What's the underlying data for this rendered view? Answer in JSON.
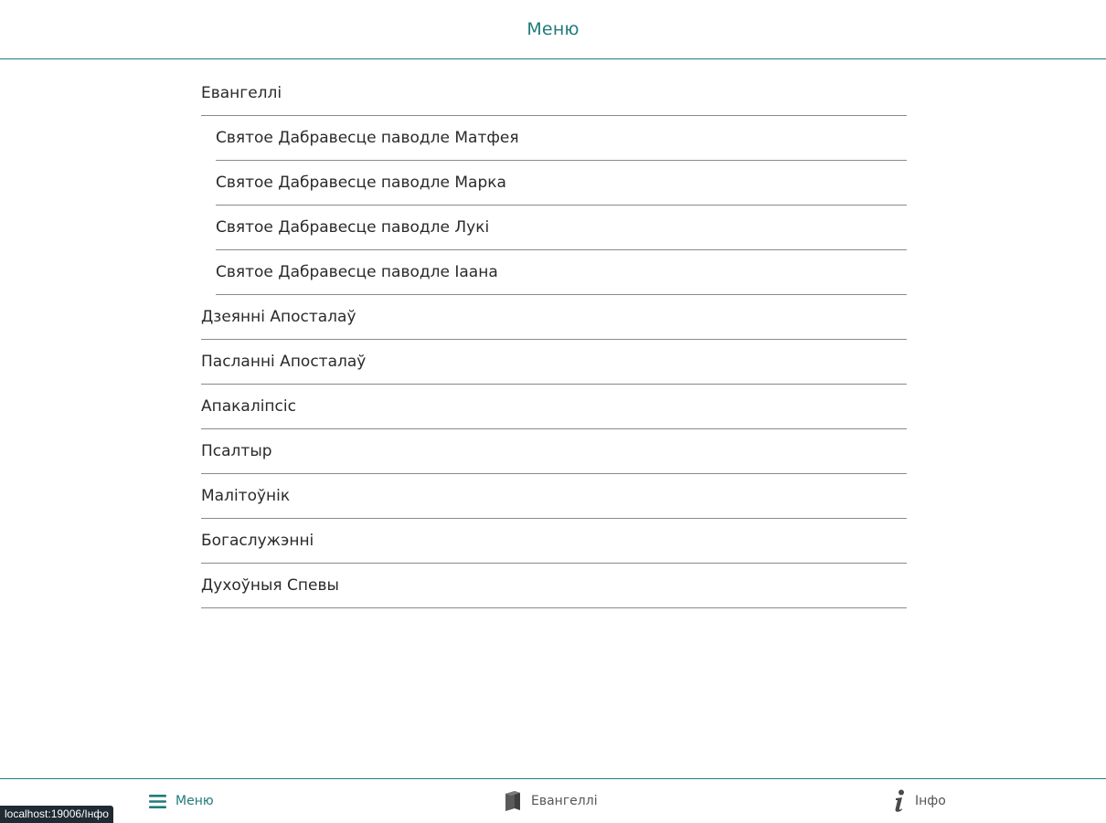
{
  "header": {
    "title": "Меню"
  },
  "menu": {
    "items": [
      {
        "label": "Евангеллі"
      },
      {
        "label": "Святое Дабравесце паводле Матфея"
      },
      {
        "label": "Святое Дабравесце паводле Марка"
      },
      {
        "label": "Святое Дабравесце паводле Лукі"
      },
      {
        "label": "Святое Дабравесце паводле Іаана"
      },
      {
        "label": "Дзеянні Апосталаў"
      },
      {
        "label": "Пасланні Апосталаў"
      },
      {
        "label": "Апакаліпсіс"
      },
      {
        "label": "Псалтыр"
      },
      {
        "label": "Малітоўнік"
      },
      {
        "label": "Богаслужэнні"
      },
      {
        "label": "Духоўныя Спевы"
      }
    ]
  },
  "bottom_nav": {
    "menu_label": "Меню",
    "gospel_label": "Евангеллі",
    "info_label": "Інфо",
    "icons": {
      "menu": "hamburger-icon",
      "gospel": "book-icon",
      "info": "info-icon"
    }
  },
  "status_bar": {
    "url": "localhost:19006/Інфо"
  },
  "colors": {
    "accent": "#217a7a",
    "divider": "#8a8a8a",
    "text": "#2a2a2a"
  }
}
